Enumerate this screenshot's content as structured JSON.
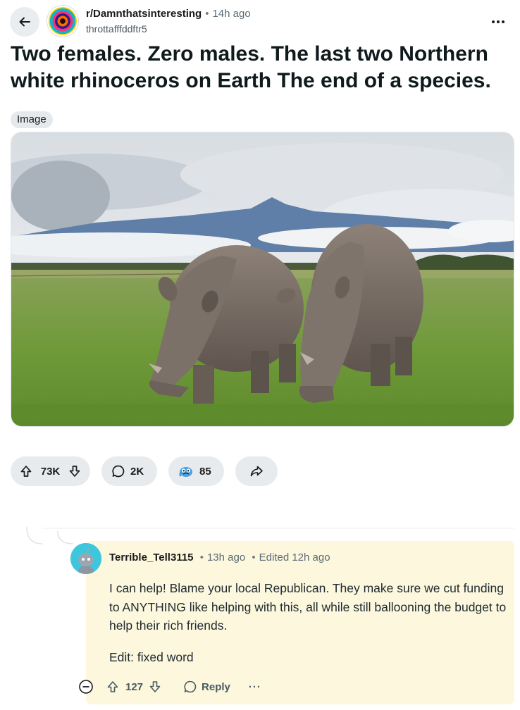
{
  "header": {
    "subreddit": "r/Damnthatsinteresting",
    "separator": "•",
    "time_ago": "14h ago",
    "author": "throttafffddftr5"
  },
  "post": {
    "title": "Two females. Zero males. The last two Northern white rhinoceros on Earth The end of a species.",
    "flair": "Image"
  },
  "actions": {
    "upvotes": "73K",
    "comments": "2K",
    "awards": "85"
  },
  "comment": {
    "username": "Terrible_Tell3115",
    "separator": "•",
    "time_ago": "13h ago",
    "edited": "Edited 12h ago",
    "body": "I can help! Blame your local Republican. They make sure we cut funding to ANYTHING like helping with this, all while still ballooning the budget to help their rich friends.",
    "edit_note": "Edit: fixed word",
    "score": "127",
    "reply_label": "Reply",
    "more_label": "···"
  },
  "icons": {
    "back": "arrow-left-icon",
    "more": "ellipsis-icon",
    "upvote": "arrow-up-icon",
    "downvote": "arrow-down-icon",
    "comment": "speech-bubble-icon",
    "award": "award-icon",
    "share": "share-arrow-icon",
    "collapse": "minus-circle-icon"
  },
  "colors": {
    "pill_bg": "#e8ebed",
    "comment_highlight": "#fcf7dd",
    "avatar_bg": "#3ec7dc"
  }
}
